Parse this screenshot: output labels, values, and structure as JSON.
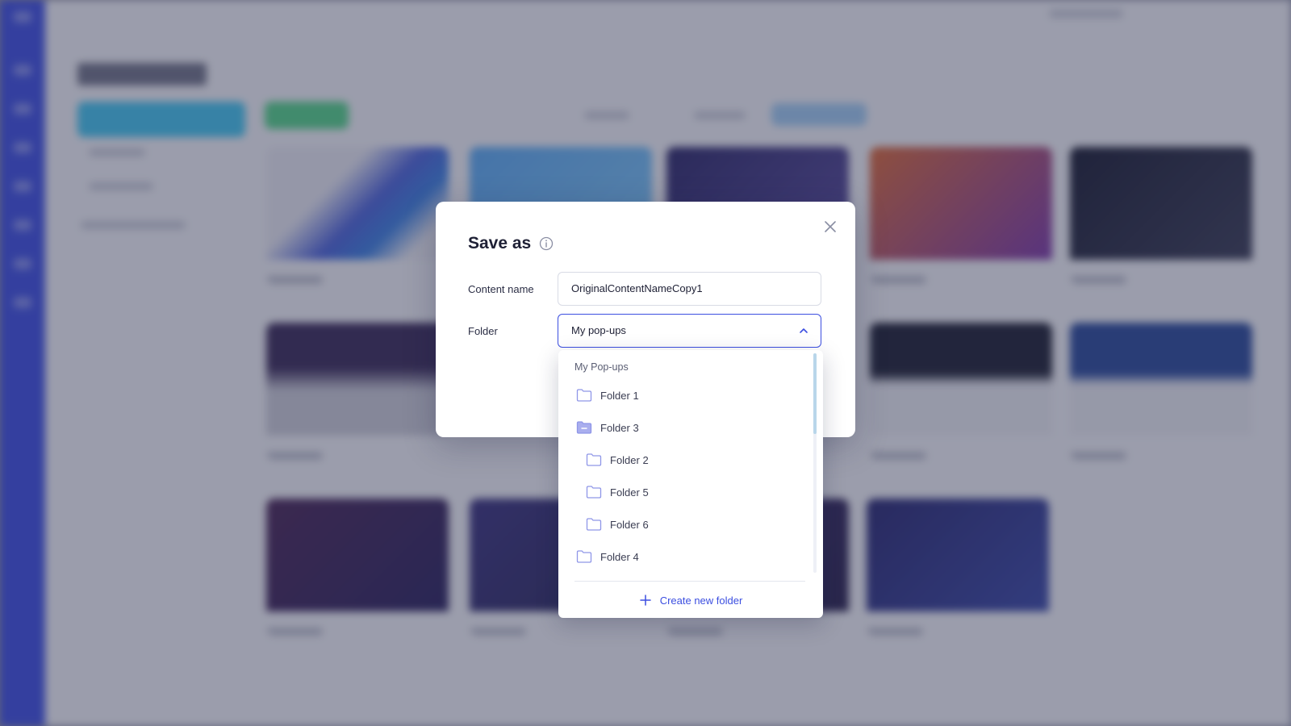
{
  "dialog": {
    "title": "Save as",
    "content_name_label": "Content name",
    "content_name_value": "OriginalContentNameCopy1",
    "folder_label": "Folder",
    "folder_selected": "My pop-ups"
  },
  "dropdown": {
    "header": "My Pop-ups",
    "items": [
      {
        "label": "Folder 1",
        "icon": "folder-icon"
      },
      {
        "label": "Folder 3",
        "icon": "folder-open-icon"
      },
      {
        "label": "Folder 2",
        "icon": "folder-icon"
      },
      {
        "label": "Folder 5",
        "icon": "folder-icon"
      },
      {
        "label": "Folder 6",
        "icon": "folder-icon"
      },
      {
        "label": "Folder 4",
        "icon": "folder-icon"
      }
    ],
    "create_label": "Create new folder"
  },
  "colors": {
    "accent": "#3b4ee0",
    "folder_icon": "#8f96e8"
  }
}
